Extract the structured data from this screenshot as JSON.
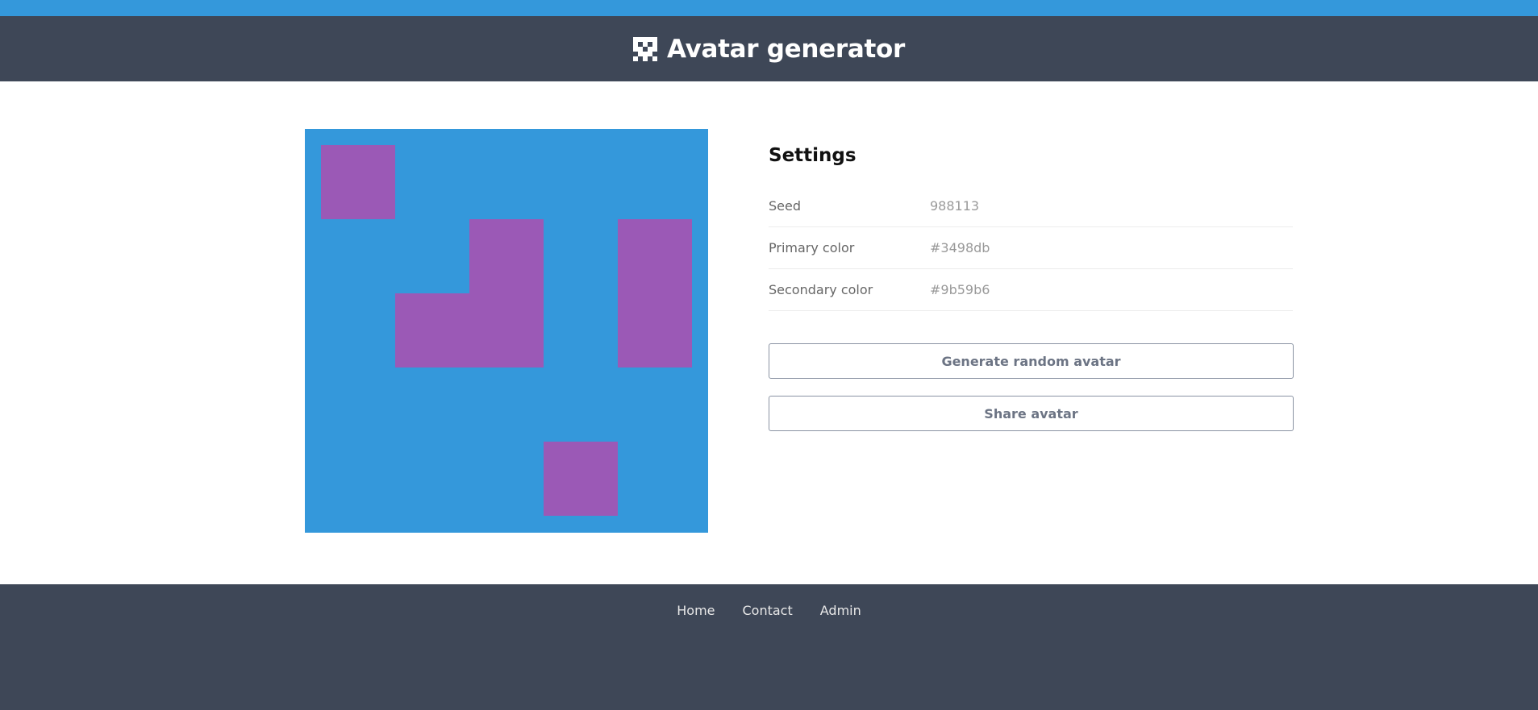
{
  "header": {
    "title": "Avatar generator",
    "logo_icon": "avatar-logo-icon"
  },
  "avatar": {
    "primary_color": "#3498db",
    "secondary_color": "#9b59b6",
    "grid_size": 5
  },
  "settings": {
    "heading": "Settings",
    "rows": [
      {
        "key": "Seed",
        "value": "988113"
      },
      {
        "key": "Primary color",
        "value": "#3498db"
      },
      {
        "key": "Secondary color",
        "value": "#9b59b6"
      }
    ]
  },
  "actions": {
    "generate_label": "Generate random avatar",
    "share_label": "Share avatar"
  },
  "footer": {
    "links": [
      "Home",
      "Contact",
      "Admin"
    ]
  }
}
